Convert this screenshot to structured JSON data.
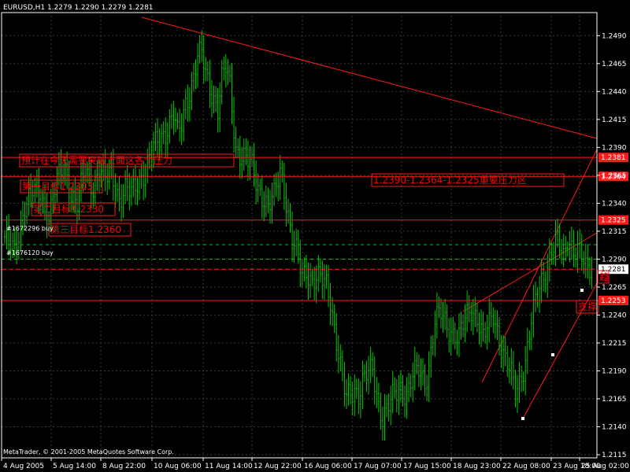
{
  "chart_data": {
    "type": "candlestick",
    "title": "EURUSD,H1  1.2279 1.2290 1.2279 1.2281",
    "symbol_label": "EURUSD,H1",
    "ohlc_label": "1.2279 1.2290 1.2279 1.2281",
    "ylim": [
      1.2115,
      1.2505
    ],
    "y_ticks": [
      "1.2490",
      "1.2465",
      "1.2440",
      "1.2415",
      "1.2390",
      "1.2365",
      "1.2340",
      "1.2315",
      "1.2290",
      "1.2265",
      "1.2240",
      "1.2215",
      "1.2190",
      "1.2165",
      "1.2140",
      "1.2115"
    ],
    "x_ticks": [
      "4 Aug 2005",
      "5 Aug 14:00",
      "8 Aug 22:00",
      "10 Aug 06:00",
      "11 Aug 14:00",
      "12 Aug 22:00",
      "16 Aug 06:00",
      "17 Aug 07:00",
      "17 Aug 15:00",
      "18 Aug 23:00",
      "22 Aug 08:00",
      "23 Aug 18:00",
      "25 Aug 02:00"
    ],
    "grid": true,
    "current_price": 1.2281,
    "price_path": [
      [
        0,
        1.231
      ],
      [
        5,
        1.2295
      ],
      [
        10,
        1.234
      ],
      [
        14,
        1.235
      ],
      [
        18,
        1.2345
      ],
      [
        22,
        1.233
      ],
      [
        26,
        1.236
      ],
      [
        30,
        1.237
      ],
      [
        33,
        1.235
      ],
      [
        36,
        1.234
      ],
      [
        40,
        1.2368
      ],
      [
        44,
        1.2355
      ],
      [
        47,
        1.2372
      ],
      [
        50,
        1.236
      ],
      [
        53,
        1.2368
      ],
      [
        57,
        1.2345
      ],
      [
        60,
        1.2352
      ],
      [
        63,
        1.2348
      ],
      [
        67,
        1.2362
      ],
      [
        70,
        1.237
      ],
      [
        73,
        1.2385
      ],
      [
        76,
        1.2395
      ],
      [
        80,
        1.2405
      ],
      [
        84,
        1.242
      ],
      [
        86,
        1.24
      ],
      [
        88,
        1.241
      ],
      [
        90,
        1.243
      ],
      [
        93,
        1.2447
      ],
      [
        96,
        1.247
      ],
      [
        98,
        1.2473
      ],
      [
        100,
        1.2455
      ],
      [
        103,
        1.244
      ],
      [
        106,
        1.2425
      ],
      [
        108,
        1.245
      ],
      [
        110,
        1.246
      ],
      [
        112,
        1.2445
      ],
      [
        115,
        1.239
      ],
      [
        117,
        1.2385
      ],
      [
        120,
        1.2378
      ],
      [
        123,
        1.2372
      ],
      [
        126,
        1.2355
      ],
      [
        129,
        1.2345
      ],
      [
        131,
        1.2335
      ],
      [
        134,
        1.2345
      ],
      [
        137,
        1.237
      ],
      [
        139,
        1.2355
      ],
      [
        141,
        1.233
      ],
      [
        143,
        1.2305
      ],
      [
        146,
        1.229
      ],
      [
        148,
        1.2275
      ],
      [
        150,
        1.2282
      ],
      [
        153,
        1.227
      ],
      [
        155,
        1.2272
      ],
      [
        158,
        1.227
      ],
      [
        160,
        1.2268
      ],
      [
        162,
        1.2255
      ],
      [
        164,
        1.223
      ],
      [
        166,
        1.2205
      ],
      [
        168,
        1.218
      ],
      [
        170,
        1.2165
      ],
      [
        172,
        1.217
      ],
      [
        174,
        1.2175
      ],
      [
        176,
        1.217
      ],
      [
        178,
        1.218
      ],
      [
        180,
        1.2185
      ],
      [
        183,
        1.219
      ],
      [
        186,
        1.216
      ],
      [
        188,
        1.215
      ],
      [
        190,
        1.2155
      ],
      [
        193,
        1.2165
      ],
      [
        195,
        1.217
      ],
      [
        197,
        1.2175
      ],
      [
        200,
        1.217
      ],
      [
        203,
        1.2185
      ],
      [
        206,
        1.219
      ],
      [
        209,
        1.218
      ],
      [
        211,
        1.2195
      ],
      [
        214,
        1.2235
      ],
      [
        217,
        1.224
      ],
      [
        220,
        1.223
      ],
      [
        223,
        1.2225
      ],
      [
        226,
        1.222
      ],
      [
        229,
        1.2235
      ],
      [
        232,
        1.2245
      ],
      [
        235,
        1.224
      ],
      [
        238,
        1.222
      ],
      [
        241,
        1.223
      ],
      [
        243,
        1.224
      ],
      [
        246,
        1.222
      ],
      [
        249,
        1.22
      ],
      [
        252,
        1.2185
      ],
      [
        254,
        1.217
      ],
      [
        256,
        1.218
      ],
      [
        259,
        1.22
      ],
      [
        262,
        1.2235
      ],
      [
        264,
        1.225
      ],
      [
        267,
        1.227
      ],
      [
        270,
        1.2285
      ],
      [
        272,
        1.23
      ],
      [
        275,
        1.2305
      ],
      [
        278,
        1.229
      ],
      [
        280,
        1.231
      ],
      [
        283,
        1.23
      ],
      [
        286,
        1.2295
      ],
      [
        289,
        1.228
      ],
      [
        292,
        1.2285
      ]
    ],
    "horizontal_lines": [
      {
        "price": 1.2381,
        "style": "solid",
        "label": "1.2381"
      },
      {
        "price": 1.2364,
        "style": "solid",
        "label": "1.2364"
      },
      {
        "price": 1.2325,
        "style": "solid",
        "label": "1.2325"
      },
      {
        "price": 1.2303,
        "style": "dashed-green"
      },
      {
        "price": 1.229,
        "style": "dashed-green"
      },
      {
        "price": 1.2281,
        "style": "dashed"
      },
      {
        "price": 1.2253,
        "style": "solid",
        "label": "1.2253"
      }
    ],
    "annotations": [
      "预计在今天需要突破上面这各个压力",
      "1.2390-1.2364-1.2325重要压力区",
      "第一目标1.2303",
      "第二目标1.2330",
      "第三目标1.2360",
      "#1672296 buy",
      "#1676120 buy",
      "支撑",
      "趋"
    ],
    "footer": "MetaTrader, © 2001-2005 MetaQuotes Software Corp."
  }
}
